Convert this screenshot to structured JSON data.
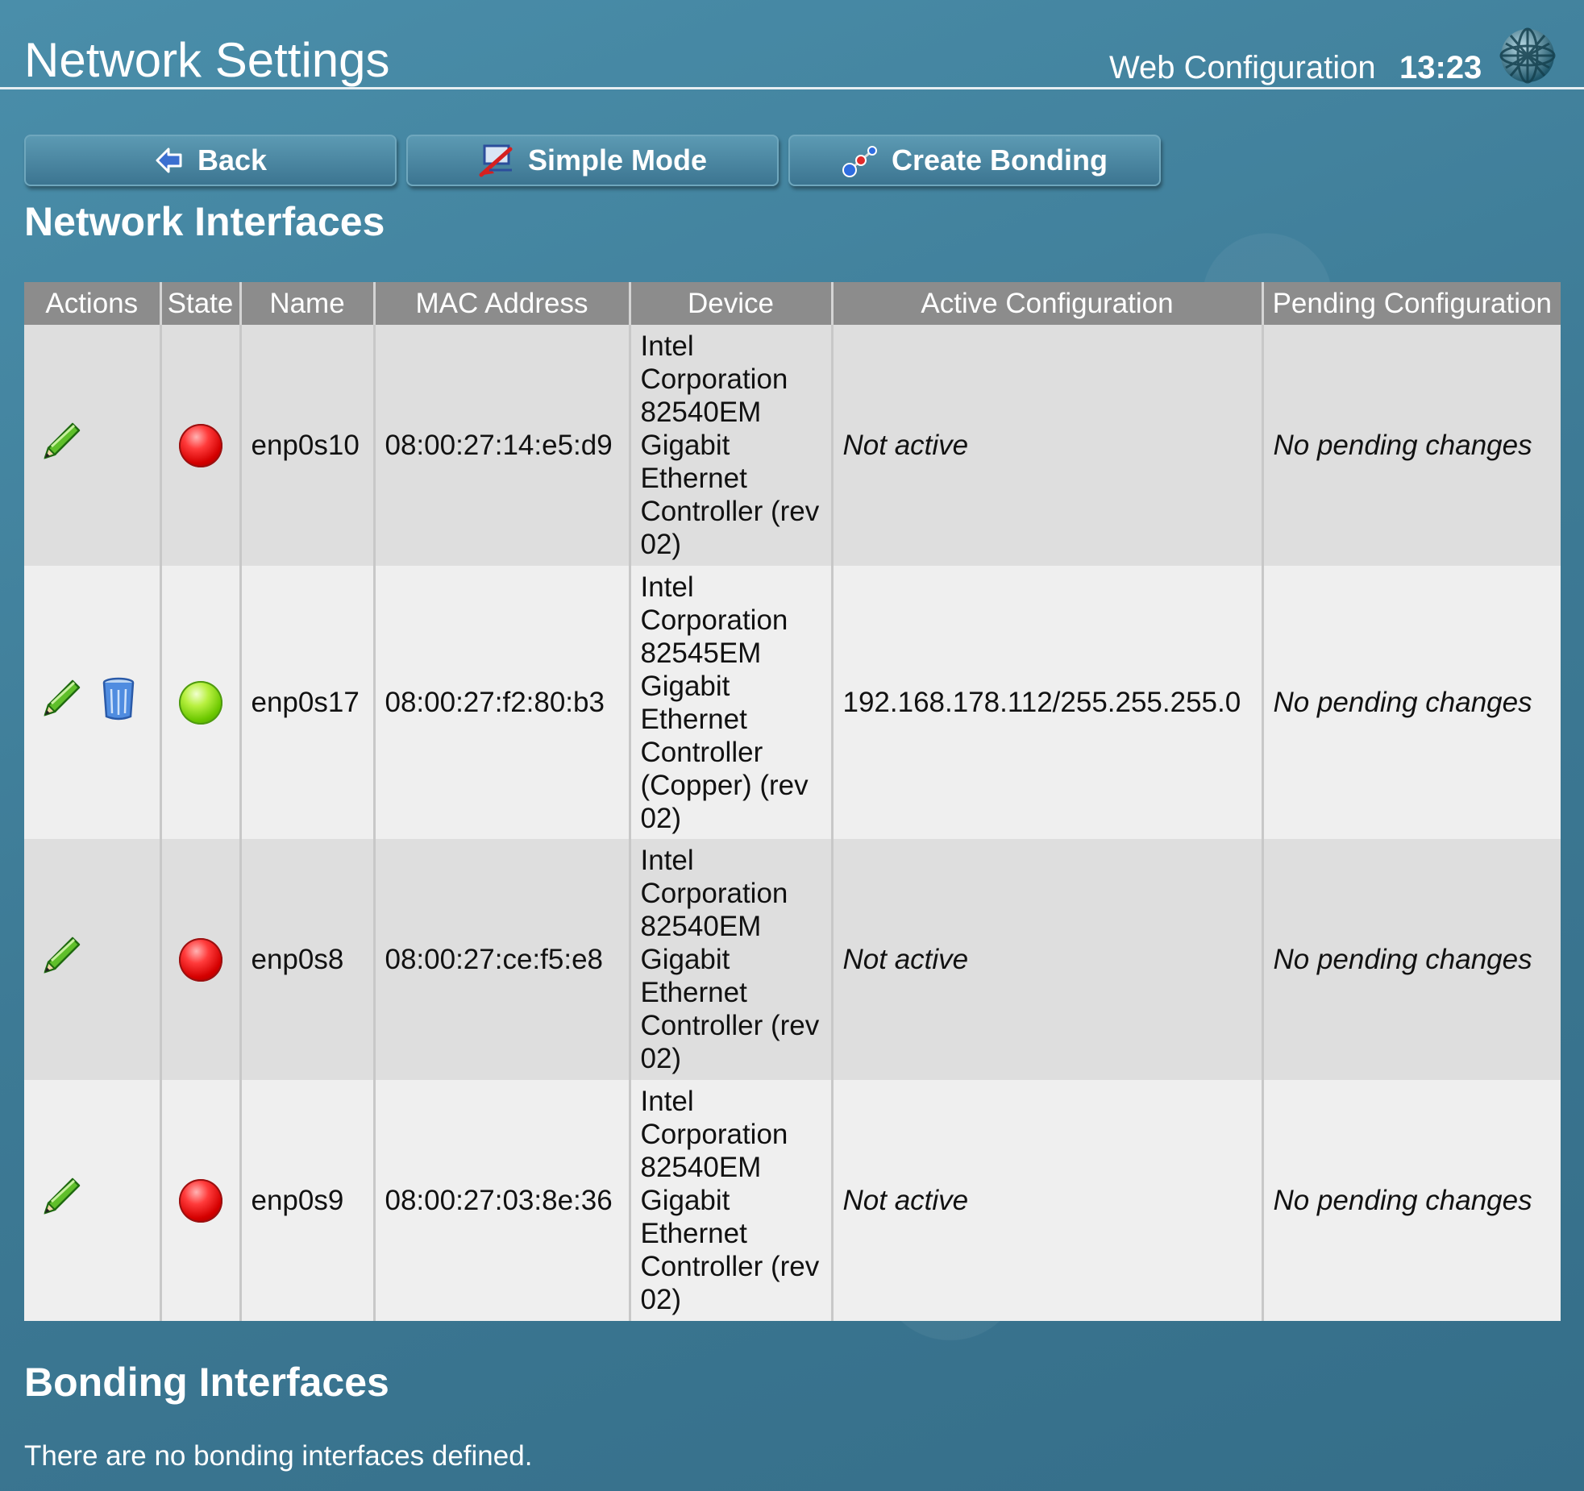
{
  "header": {
    "title": "Network Settings",
    "subtitle": "Web Configuration",
    "clock": "13:23",
    "logo_icon": "globe-icon"
  },
  "toolbar": {
    "back_label": "Back",
    "back_icon": "back-arrow-icon",
    "simple_mode_label": "Simple Mode",
    "simple_mode_icon": "simple-mode-icon",
    "create_bonding_label": "Create Bonding",
    "create_bonding_icon": "bonding-icon"
  },
  "network_interfaces": {
    "title": "Network Interfaces",
    "columns": [
      "Actions",
      "State",
      "Name",
      "MAC Address",
      "Device",
      "Active Configuration",
      "Pending Configuration"
    ],
    "rows": [
      {
        "actions": [
          "edit-icon"
        ],
        "state": "down",
        "name": "enp0s10",
        "mac": "08:00:27:14:e5:d9",
        "device": "Intel Corporation 82540EM Gigabit Ethernet Controller (rev 02)",
        "active": "Not active",
        "pending": "No pending changes"
      },
      {
        "actions": [
          "edit-icon",
          "delete-icon"
        ],
        "state": "up",
        "name": "enp0s17",
        "mac": "08:00:27:f2:80:b3",
        "device": "Intel Corporation 82545EM Gigabit Ethernet Controller (Copper) (rev 02)",
        "active": "192.168.178.112/255.255.255.0",
        "pending": "No pending changes"
      },
      {
        "actions": [
          "edit-icon"
        ],
        "state": "down",
        "name": "enp0s8",
        "mac": "08:00:27:ce:f5:e8",
        "device": "Intel Corporation 82540EM Gigabit Ethernet Controller (rev 02)",
        "active": "Not active",
        "pending": "No pending changes"
      },
      {
        "actions": [
          "edit-icon"
        ],
        "state": "down",
        "name": "enp0s9",
        "mac": "08:00:27:03:8e:36",
        "device": "Intel Corporation 82540EM Gigabit Ethernet Controller (rev 02)",
        "active": "Not active",
        "pending": "No pending changes"
      }
    ]
  },
  "bonding_interfaces": {
    "title": "Bonding Interfaces",
    "empty_message": "There are no bonding interfaces defined."
  },
  "colors": {
    "background": "#3f7d98",
    "table_header": "#8c8c8c",
    "row_odd": "#dedede",
    "row_even": "#efefef",
    "state_down": "#d40000",
    "state_up": "#6cc800"
  }
}
